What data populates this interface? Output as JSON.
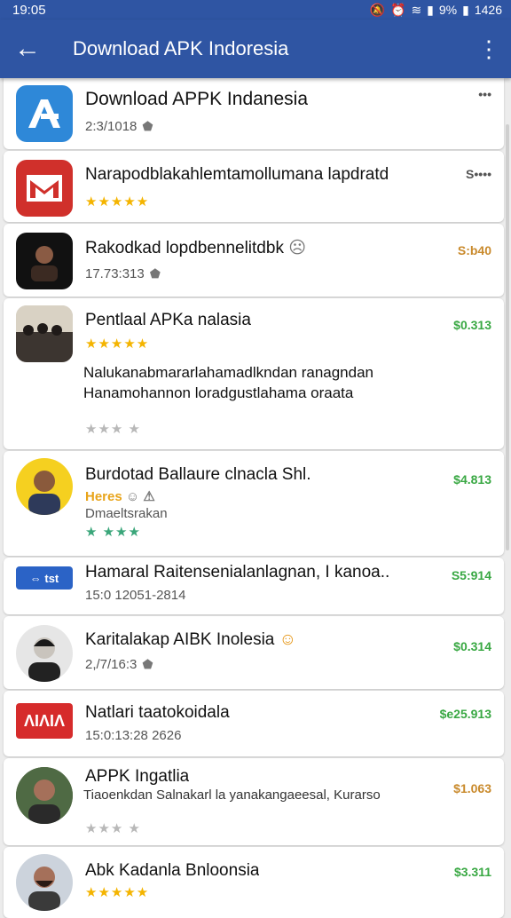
{
  "status": {
    "time": "19:05",
    "battery": "9%",
    "clock": "1426",
    "icons": [
      "mute-icon",
      "alarm-icon",
      "sync-icon",
      "wifi-icon",
      "signal-icon",
      "battery-icon"
    ]
  },
  "appbar": {
    "title": "Download APK Indoresia",
    "back_icon": "arrow-back-icon",
    "more_icon": "more-vert-icon"
  },
  "items": [
    {
      "name": "Download APPK Indanesia",
      "sub": "2:3/1018",
      "price": "•••",
      "icon": "apk-logo-icon",
      "color": "#2e88d8"
    },
    {
      "name": "Narapodblakahlemtamollumana lapdratd",
      "stars": "★★★★★",
      "price": "S••••",
      "icon": "gmail-style-icon",
      "color": "#d0302b"
    },
    {
      "name": "Rakodkad lopdbennelitdbk",
      "sub": "17.73:313",
      "price": "S:b40",
      "icon": "person-photo-icon"
    },
    {
      "name": "Pentlaal APKa nalasia",
      "stars": "★★★★★",
      "desc": "Nalukanabmararlahamadlkndan ranagndan Hanamohannon loradgustlahama oraata",
      "stars2": "★★★ ★",
      "price": "$0.313",
      "icon": "group-photo-icon"
    },
    {
      "name": "Burdotad Ballaure clnacla Shl.",
      "sub_accent": "Heres",
      "sub2": "Dmaeltsrakan",
      "stars2": "★ ★★★",
      "price": "$4.813",
      "icon": "avatar-photo-icon",
      "color": "#f5d020"
    },
    {
      "name": "Hamaral Raitensenialanlagnan, I kanoa..",
      "sub": "15:0 12051-2814",
      "price": "S5:914",
      "icon": "blue-banner-icon",
      "color": "#2b63c6"
    },
    {
      "name": "Karitalakap AIBK Inolesia",
      "sub": "2,/7/16:3",
      "price": "$0.314",
      "icon": "man-portrait-icon"
    },
    {
      "name": "Natlari taatokoidala",
      "sub": "15:0:13:28 2626",
      "price": "$e25.913",
      "icon": "red-logo-icon",
      "color": "#d62b2b"
    },
    {
      "name": "APPK Ingatlia",
      "desc": "Tiaoenkdan Salnakarl la yanakangaeesal, Kurarso",
      "stars2": "★★★ ★",
      "price": "$1.063",
      "icon": "man-photo-icon"
    },
    {
      "name": "Abk Kadanla Bnloonsia",
      "stars": "★★★★★",
      "price": "$3.311",
      "icon": "bearded-man-icon"
    }
  ]
}
